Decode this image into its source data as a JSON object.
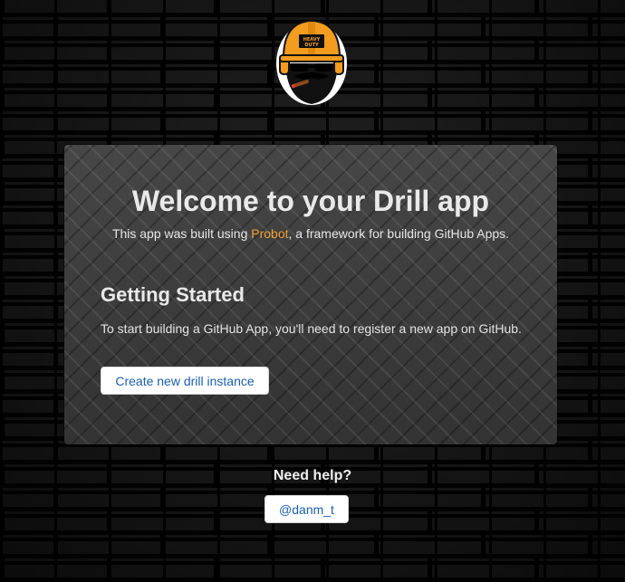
{
  "card": {
    "title": "Welcome to your Drill app",
    "subtitle_before": "This app was built using ",
    "subtitle_link": "Probot",
    "subtitle_after": ", a framework for building GitHub Apps."
  },
  "getting_started": {
    "heading": "Getting Started",
    "text": "To start building a GitHub App, you'll need to register a new app on GitHub.",
    "button_label": "Create new drill instance"
  },
  "help": {
    "heading": "Need help?",
    "button_label": "@danm_t"
  },
  "logo": {
    "helmet_text_1": "HEAVY",
    "helmet_text_2": "DUTY"
  },
  "colors": {
    "accent_link": "#f0a030",
    "button_text": "#1a5fb4",
    "helmet": "#f39c1f"
  }
}
